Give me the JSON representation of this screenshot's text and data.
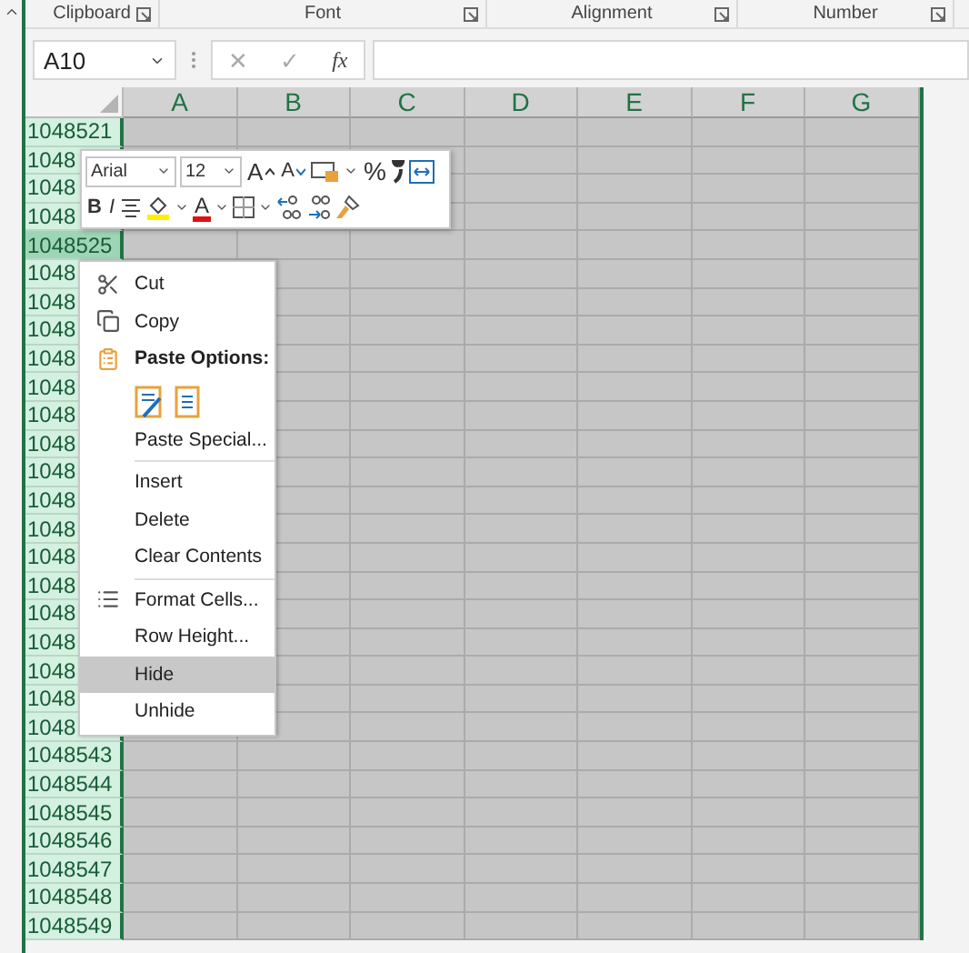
{
  "ribbon_groups": [
    {
      "label": "Clipboard"
    },
    {
      "label": "Font"
    },
    {
      "label": "Alignment"
    },
    {
      "label": "Number"
    }
  ],
  "formula_bar": {
    "name_box": "A10",
    "fx": "fx",
    "cancel": "✕",
    "enter": "✓"
  },
  "columns": [
    {
      "label": "A"
    },
    {
      "label": "B"
    },
    {
      "label": "C"
    },
    {
      "label": "D"
    },
    {
      "label": "E"
    },
    {
      "label": "F"
    },
    {
      "label": "G"
    }
  ],
  "rows": [
    {
      "label": "1048521",
      "selected": true,
      "active": false
    },
    {
      "label": "1048",
      "selected": true,
      "active": false
    },
    {
      "label": "1048",
      "selected": true,
      "active": false
    },
    {
      "label": "1048",
      "selected": true,
      "active": false
    },
    {
      "label": "1048525",
      "selected": true,
      "active": true
    },
    {
      "label": "1048",
      "selected": true,
      "active": false
    },
    {
      "label": "1048",
      "selected": true,
      "active": false
    },
    {
      "label": "1048",
      "selected": true,
      "active": false
    },
    {
      "label": "1048",
      "selected": true,
      "active": false
    },
    {
      "label": "1048",
      "selected": true,
      "active": false
    },
    {
      "label": "1048",
      "selected": true,
      "active": false
    },
    {
      "label": "1048",
      "selected": true,
      "active": false
    },
    {
      "label": "1048",
      "selected": true,
      "active": false
    },
    {
      "label": "1048",
      "selected": true,
      "active": false
    },
    {
      "label": "1048",
      "selected": true,
      "active": false
    },
    {
      "label": "1048",
      "selected": true,
      "active": false
    },
    {
      "label": "1048",
      "selected": true,
      "active": false
    },
    {
      "label": "1048",
      "selected": true,
      "active": false
    },
    {
      "label": "1048",
      "selected": true,
      "active": false
    },
    {
      "label": "1048",
      "selected": true,
      "active": false
    },
    {
      "label": "1048",
      "selected": true,
      "active": false
    },
    {
      "label": "1048",
      "selected": true,
      "active": false
    },
    {
      "label": "1048543",
      "selected": true,
      "active": false
    },
    {
      "label": "1048544",
      "selected": true,
      "active": false
    },
    {
      "label": "1048545",
      "selected": true,
      "active": false
    },
    {
      "label": "1048546",
      "selected": true,
      "active": false
    },
    {
      "label": "1048547",
      "selected": true,
      "active": false
    },
    {
      "label": "1048548",
      "selected": true,
      "active": false
    },
    {
      "label": "1048549",
      "selected": true,
      "active": false
    }
  ],
  "mini_toolbar": {
    "top_row": [
      {
        "kind": "font_select",
        "label": "Arial"
      },
      {
        "kind": "size_select",
        "label": "12"
      },
      {
        "kind": "grow_font",
        "label": "A"
      },
      {
        "kind": "shrink_font",
        "label": "A"
      },
      {
        "kind": "accounting",
        "dropdown": true
      },
      {
        "kind": "text",
        "label": "%"
      },
      {
        "kind": "comma"
      },
      {
        "kind": "merge"
      }
    ],
    "bottom_row": [
      {
        "kind": "bold",
        "label": "B"
      },
      {
        "kind": "italic",
        "label": "I"
      },
      {
        "kind": "center"
      },
      {
        "kind": "fill_color",
        "dropdown": true
      },
      {
        "kind": "font_color",
        "label": "A",
        "dropdown": true
      },
      {
        "kind": "borders",
        "dropdown": true
      },
      {
        "kind": "increase_decimal"
      },
      {
        "kind": "decrease_decimal"
      },
      {
        "kind": "painter"
      }
    ]
  },
  "context_menu": [
    {
      "kind": "cut",
      "label": "Cut",
      "selected": false
    },
    {
      "kind": "copy",
      "label": "Copy",
      "selected": false
    },
    {
      "kind": "header",
      "label": "Paste Options:"
    },
    {
      "kind": "paste_icons"
    },
    {
      "kind": "command",
      "label": "Paste Special...",
      "selected": false
    },
    {
      "kind": "separator"
    },
    {
      "kind": "command",
      "label": "Insert",
      "selected": false
    },
    {
      "kind": "command",
      "label": "Delete",
      "selected": false
    },
    {
      "kind": "command",
      "label": "Clear Contents",
      "selected": false
    },
    {
      "kind": "separator"
    },
    {
      "kind": "format_cells",
      "label": "Format Cells...",
      "selected": false
    },
    {
      "kind": "command",
      "label": "Row Height...",
      "selected": false
    },
    {
      "kind": "command",
      "label": "Hide",
      "selected": true
    },
    {
      "kind": "command",
      "label": "Unhide",
      "selected": false
    }
  ]
}
